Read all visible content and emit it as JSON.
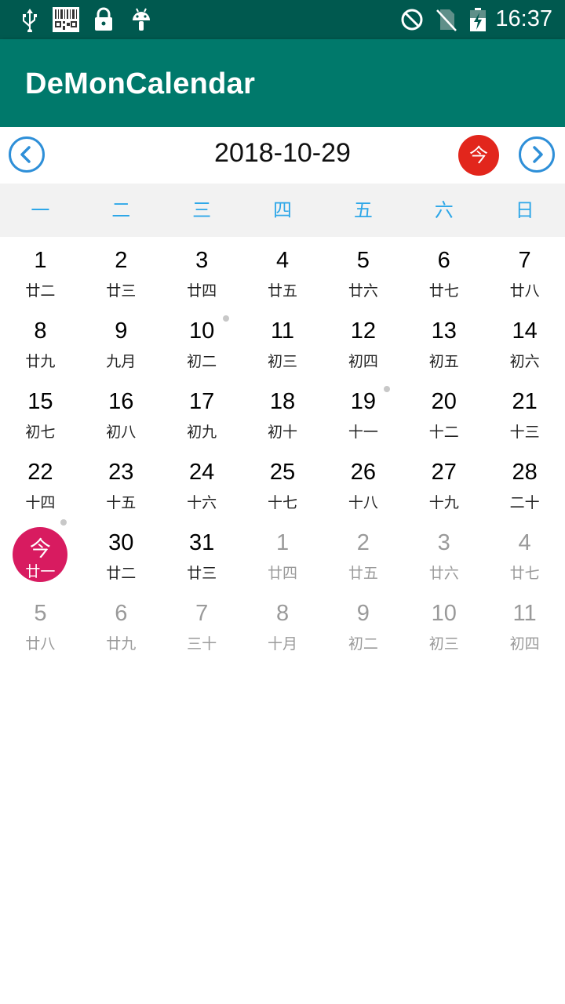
{
  "status_bar": {
    "time": "16:37",
    "left_icons": [
      "usb-icon",
      "barcode-icon",
      "lock-icon",
      "android-icon"
    ],
    "right_icons": [
      "do-not-disturb-icon",
      "no-sim-icon",
      "battery-charging-icon"
    ]
  },
  "app_bar": {
    "title": "DeMonCalendar"
  },
  "toolbar": {
    "current_date": "2018-10-29",
    "today_label": "今",
    "prev_icon": "chevron-left-icon",
    "next_icon": "chevron-right-icon"
  },
  "weekdays": [
    "一",
    "二",
    "三",
    "四",
    "五",
    "六",
    "日"
  ],
  "calendar": {
    "rows": [
      [
        {
          "day": "1",
          "lunar": "廿二"
        },
        {
          "day": "2",
          "lunar": "廿三"
        },
        {
          "day": "3",
          "lunar": "廿四"
        },
        {
          "day": "4",
          "lunar": "廿五"
        },
        {
          "day": "5",
          "lunar": "廿六"
        },
        {
          "day": "6",
          "lunar": "廿七"
        },
        {
          "day": "7",
          "lunar": "廿八"
        }
      ],
      [
        {
          "day": "8",
          "lunar": "廿九"
        },
        {
          "day": "9",
          "lunar": "九月"
        },
        {
          "day": "10",
          "lunar": "初二",
          "dot": true
        },
        {
          "day": "11",
          "lunar": "初三"
        },
        {
          "day": "12",
          "lunar": "初四"
        },
        {
          "day": "13",
          "lunar": "初五"
        },
        {
          "day": "14",
          "lunar": "初六"
        }
      ],
      [
        {
          "day": "15",
          "lunar": "初七"
        },
        {
          "day": "16",
          "lunar": "初八"
        },
        {
          "day": "17",
          "lunar": "初九"
        },
        {
          "day": "18",
          "lunar": "初十"
        },
        {
          "day": "19",
          "lunar": "十一",
          "dot": true
        },
        {
          "day": "20",
          "lunar": "十二"
        },
        {
          "day": "21",
          "lunar": "十三"
        }
      ],
      [
        {
          "day": "22",
          "lunar": "十四"
        },
        {
          "day": "23",
          "lunar": "十五"
        },
        {
          "day": "24",
          "lunar": "十六"
        },
        {
          "day": "25",
          "lunar": "十七"
        },
        {
          "day": "26",
          "lunar": "十八"
        },
        {
          "day": "27",
          "lunar": "十九"
        },
        {
          "day": "28",
          "lunar": "二十"
        }
      ],
      [
        {
          "day": "今",
          "lunar": "廿一",
          "today": true,
          "dot": true
        },
        {
          "day": "30",
          "lunar": "廿二"
        },
        {
          "day": "31",
          "lunar": "廿三"
        },
        {
          "day": "1",
          "lunar": "廿四",
          "other": true
        },
        {
          "day": "2",
          "lunar": "廿五",
          "other": true
        },
        {
          "day": "3",
          "lunar": "廿六",
          "other": true
        },
        {
          "day": "4",
          "lunar": "廿七",
          "other": true
        }
      ],
      [
        {
          "day": "5",
          "lunar": "廿八",
          "other": true
        },
        {
          "day": "6",
          "lunar": "廿九",
          "other": true
        },
        {
          "day": "7",
          "lunar": "三十",
          "other": true
        },
        {
          "day": "8",
          "lunar": "十月",
          "other": true
        },
        {
          "day": "9",
          "lunar": "初二",
          "other": true
        },
        {
          "day": "10",
          "lunar": "初三",
          "other": true
        },
        {
          "day": "11",
          "lunar": "初四",
          "other": true
        }
      ]
    ]
  },
  "colors": {
    "status_bar": "#00594f",
    "app_bar": "#00796b",
    "weekday_text": "#2ea7e8",
    "today_circle": "#d81b60",
    "today_button": "#e2261c",
    "nav_ring": "#2e8fd8"
  }
}
